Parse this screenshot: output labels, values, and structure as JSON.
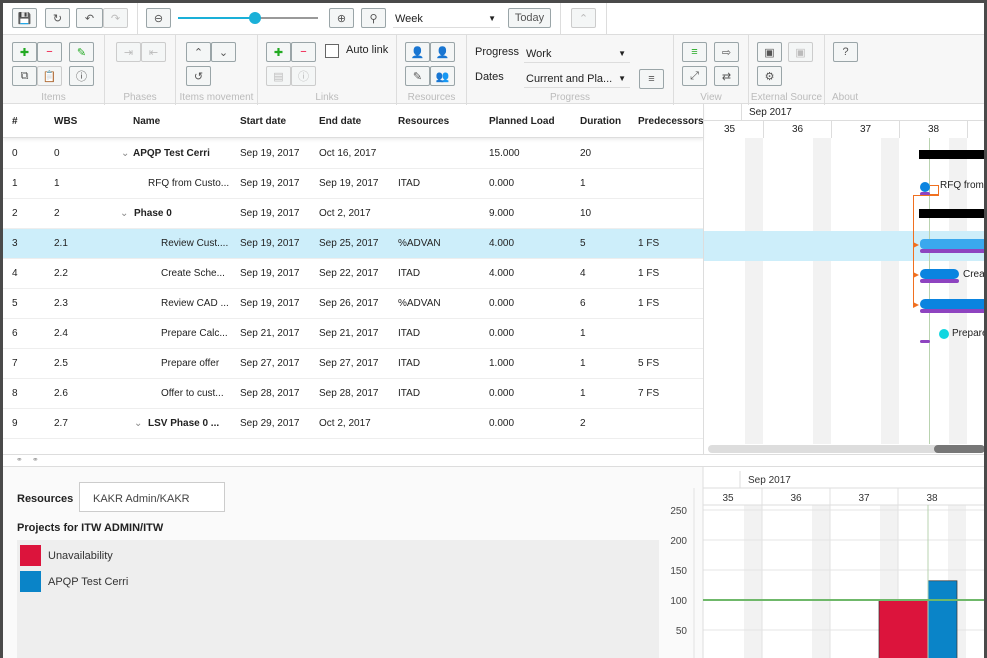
{
  "toolbar": {
    "zoom_level": 0.55,
    "scale": "Week",
    "today": "Today"
  },
  "ribbon": {
    "groups": [
      "Items",
      "Phases",
      "Items movement",
      "Links",
      "Resources",
      "Progress",
      "View",
      "External Source",
      "About"
    ],
    "auto_link": "Auto link",
    "progress_label": "Progress",
    "progress_value": "Work",
    "dates_label": "Dates",
    "dates_value": "Current and Pla...",
    "about": "?"
  },
  "table": {
    "columns": [
      "#",
      "WBS",
      "Name",
      "Start date",
      "End date",
      "Resources",
      "Planned Load",
      "Duration",
      "Predecessors"
    ],
    "rows": [
      {
        "n": "0",
        "wbs": "0",
        "name": "APQP Test Cerri",
        "start": "Sep 19, 2017",
        "end": "Oct 16, 2017",
        "res": "",
        "load": "15.000",
        "dur": "20",
        "pred": "",
        "level": 0,
        "group": true
      },
      {
        "n": "1",
        "wbs": "1",
        "name": "RFQ from Custo...",
        "start": "Sep 19, 2017",
        "end": "Sep 19, 2017",
        "res": "ITAD",
        "load": "0.000",
        "dur": "1",
        "pred": "",
        "level": 1
      },
      {
        "n": "2",
        "wbs": "2",
        "name": "Phase 0",
        "start": "Sep 19, 2017",
        "end": "Oct 2, 2017",
        "res": "",
        "load": "9.000",
        "dur": "10",
        "pred": "",
        "level": 1,
        "group": true
      },
      {
        "n": "3",
        "wbs": "2.1",
        "name": "Review Cust....",
        "start": "Sep 19, 2017",
        "end": "Sep 25, 2017",
        "res": "%ADVAN",
        "load": "4.000",
        "dur": "5",
        "pred": "1 FS",
        "level": 2,
        "selected": true
      },
      {
        "n": "4",
        "wbs": "2.2",
        "name": "Create Sche...",
        "start": "Sep 19, 2017",
        "end": "Sep 22, 2017",
        "res": "ITAD",
        "load": "4.000",
        "dur": "4",
        "pred": "1 FS",
        "level": 2
      },
      {
        "n": "5",
        "wbs": "2.3",
        "name": "Review CAD ...",
        "start": "Sep 19, 2017",
        "end": "Sep 26, 2017",
        "res": "%ADVAN",
        "load": "0.000",
        "dur": "6",
        "pred": "1 FS",
        "level": 2
      },
      {
        "n": "6",
        "wbs": "2.4",
        "name": "Prepare Calc...",
        "start": "Sep 21, 2017",
        "end": "Sep 21, 2017",
        "res": "ITAD",
        "load": "0.000",
        "dur": "1",
        "pred": "",
        "level": 2
      },
      {
        "n": "7",
        "wbs": "2.5",
        "name": "Prepare offer",
        "start": "Sep 27, 2017",
        "end": "Sep 27, 2017",
        "res": "ITAD",
        "load": "1.000",
        "dur": "1",
        "pred": "5 FS",
        "level": 2
      },
      {
        "n": "8",
        "wbs": "2.6",
        "name": "Offer to cust...",
        "start": "Sep 28, 2017",
        "end": "Sep 28, 2017",
        "res": "ITAD",
        "load": "0.000",
        "dur": "1",
        "pred": "7 FS",
        "level": 2
      },
      {
        "n": "9",
        "wbs": "2.7",
        "name": "LSV Phase 0 ...",
        "start": "Sep 29, 2017",
        "end": "Oct 2, 2017",
        "res": "",
        "load": "0.000",
        "dur": "2",
        "pred": "",
        "level": 2,
        "group": true
      }
    ]
  },
  "gantt": {
    "month": "Sep 2017",
    "weeks": [
      "35",
      "36",
      "37",
      "38"
    ],
    "labels": {
      "rfq": "RFQ from C",
      "create": "Creat",
      "prepare": "Prepare"
    }
  },
  "resources_panel": {
    "label": "Resources",
    "value": "KAKR Admin/KAKR",
    "projects_title": "Projects for ITW ADMIN/ITW",
    "legend": [
      {
        "name": "Unavailability",
        "color": "#dc143c"
      },
      {
        "name": "APQP Test Cerri",
        "color": "#0a84c8"
      }
    ]
  },
  "chart_data": {
    "type": "bar",
    "month": "Sep 2017",
    "categories": [
      "35",
      "36",
      "37",
      "38"
    ],
    "yticks": [
      "250",
      "200",
      "150",
      "100",
      "50"
    ],
    "ylim": [
      0,
      260
    ],
    "capacity_line": 100,
    "series": [
      {
        "name": "Unavailability",
        "color": "#dc143c",
        "values": [
          0,
          0,
          100,
          0
        ]
      },
      {
        "name": "APQP Test Cerri",
        "color": "#0a84c8",
        "values": [
          0,
          0,
          0,
          132
        ]
      }
    ]
  }
}
